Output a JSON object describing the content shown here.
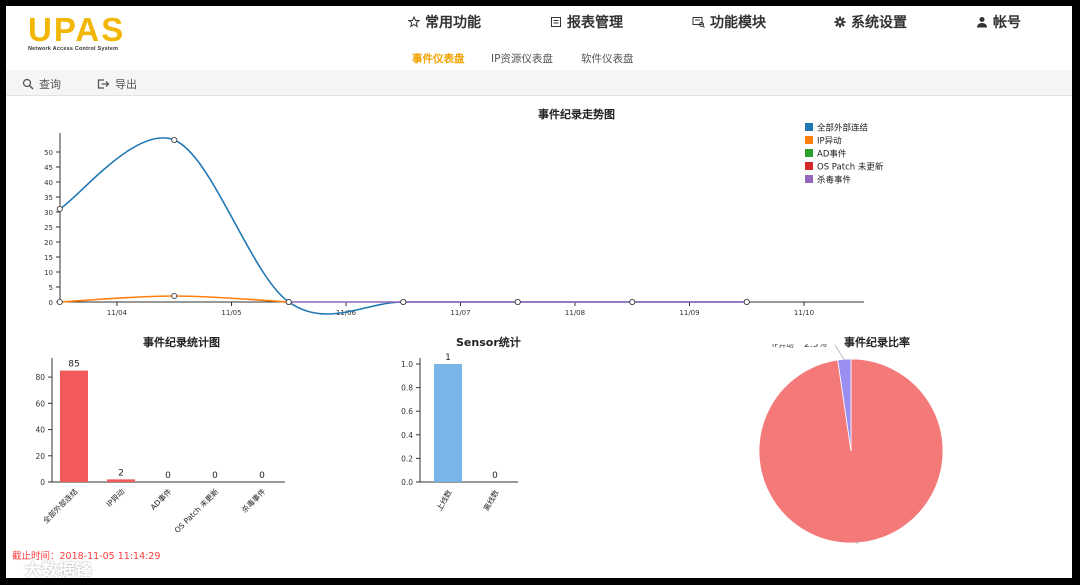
{
  "app": {
    "logo": "UPAS",
    "logo_subtitle": "Network Access Control System"
  },
  "nav": {
    "items": [
      {
        "label": "常用功能",
        "icon": "star-icon"
      },
      {
        "label": "报表管理",
        "icon": "report-icon"
      },
      {
        "label": "功能模块",
        "icon": "module-icon"
      },
      {
        "label": "系统设置",
        "icon": "gear-icon"
      },
      {
        "label": "帐号",
        "icon": "user-icon"
      }
    ]
  },
  "subtabs": {
    "items": [
      "事件仪表盘",
      "IP资源仪表盘",
      "软件仪表盘"
    ],
    "active": "事件仪表盘"
  },
  "toolbar": {
    "query_label": "查询",
    "export_label": "导出"
  },
  "colors": {
    "accent": "#f2a300",
    "series": [
      "#1f77b4",
      "#ff7f0e",
      "#2ca02c",
      "#d62728",
      "#9467bd"
    ],
    "bar_red": "#f25a5a",
    "bar_blue": "#7ab4e8",
    "pie_main": "#f47a7a",
    "pie_slice": "#9a8ff0"
  },
  "footer": {
    "timestamp": "截止时间：2018-11-05 11:14:29",
    "watermark": "大数据锋"
  },
  "chart_data": [
    {
      "type": "line",
      "title": "事件纪录走势图",
      "x": [
        "11/04",
        "11/05",
        "11/06",
        "11/07",
        "11/08",
        "11/09",
        "11/10"
      ],
      "yticks": [
        0,
        5,
        10,
        15,
        20,
        25,
        30,
        35,
        40,
        45,
        50
      ],
      "ylim": [
        0,
        55
      ],
      "series": [
        {
          "name": "全部外部连结",
          "points": [
            [
              -0.5,
              31
            ],
            [
              0.5,
              54
            ],
            [
              1.5,
              0
            ],
            [
              2.5,
              0
            ],
            [
              3.5,
              0
            ],
            [
              4.5,
              0
            ],
            [
              5.5,
              0
            ]
          ]
        },
        {
          "name": "IP异动",
          "points": [
            [
              -0.5,
              0
            ],
            [
              0.5,
              2
            ],
            [
              1.5,
              0
            ]
          ]
        },
        {
          "name": "AD事件",
          "points": []
        },
        {
          "name": "OS Patch 未更新",
          "points": []
        },
        {
          "name": "杀毒事件",
          "points": [
            [
              1.5,
              0
            ],
            [
              2.5,
              0
            ],
            [
              3.5,
              0
            ],
            [
              4.5,
              0
            ],
            [
              5.5,
              0
            ]
          ]
        }
      ],
      "legend": "top-right",
      "grid": false
    },
    {
      "type": "bar",
      "title": "事件纪录统计图",
      "categories": [
        "全部外部连结",
        "IP异动",
        "AD事件",
        "OS Patch 未更新",
        "杀毒事件"
      ],
      "values": [
        85,
        2,
        0,
        0,
        0
      ],
      "yticks": [
        0,
        20,
        40,
        60,
        80
      ],
      "ylim": [
        0,
        90
      ]
    },
    {
      "type": "bar",
      "title": "Sensor统计",
      "categories": [
        "上线数",
        "离线数"
      ],
      "values": [
        1,
        0
      ],
      "yticks": [
        "0.0",
        "0.2",
        "0.4",
        "0.6",
        "0.8",
        "1.0"
      ],
      "ylim": [
        0,
        1.0
      ]
    },
    {
      "type": "pie",
      "title": "事件纪录比率",
      "slices": [
        {
          "label": "全部外部连结",
          "percent": 97.7,
          "pct_text": "97.7%"
        },
        {
          "label": "IP异动",
          "percent": 2.3,
          "pct_text": "2.3%"
        }
      ]
    }
  ]
}
